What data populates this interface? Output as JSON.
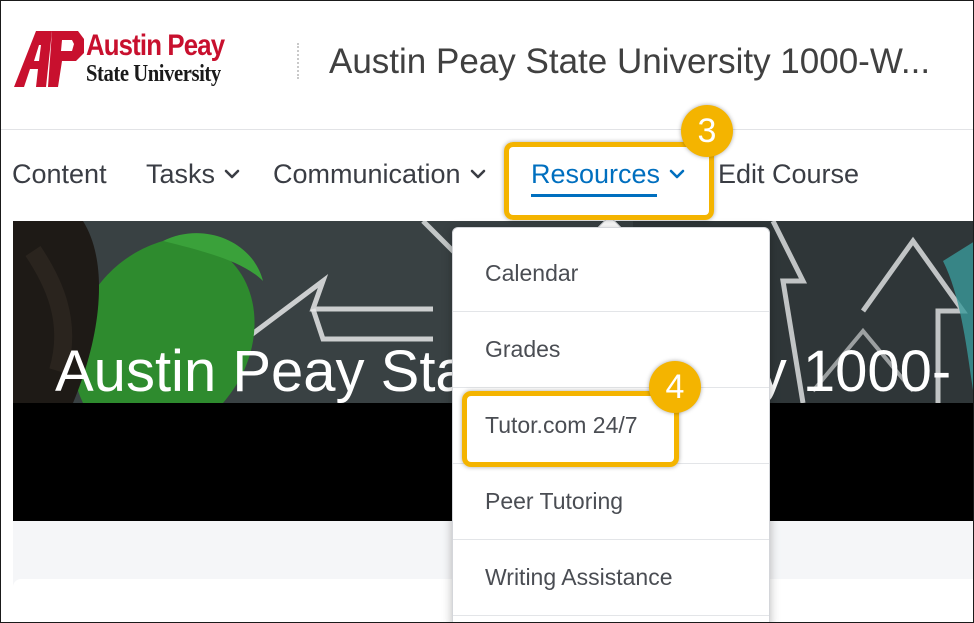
{
  "header": {
    "logo_line1": "Austin Peay",
    "logo_line2": "State University",
    "course_title": "Austin Peay State University 1000-W..."
  },
  "nav": {
    "items": [
      {
        "label": "Content",
        "has_menu": false
      },
      {
        "label": "Tasks",
        "has_menu": true
      },
      {
        "label": "Communication",
        "has_menu": true
      },
      {
        "label": "Resources",
        "has_menu": true,
        "active": true
      },
      {
        "label": "Edit Course",
        "has_menu": false
      }
    ]
  },
  "banner": {
    "title": "Austin Peay State University 1000-"
  },
  "resources_menu": {
    "items": [
      "Calendar",
      "Grades",
      "Tutor.com 24/7",
      "Peer Tutoring",
      "Writing Assistance"
    ]
  },
  "callouts": {
    "step_resources": "3",
    "step_tutor": "4"
  },
  "colors": {
    "accent_blue": "#006fbf",
    "highlight_yellow": "#f4b400",
    "brand_red": "#c8102e"
  }
}
